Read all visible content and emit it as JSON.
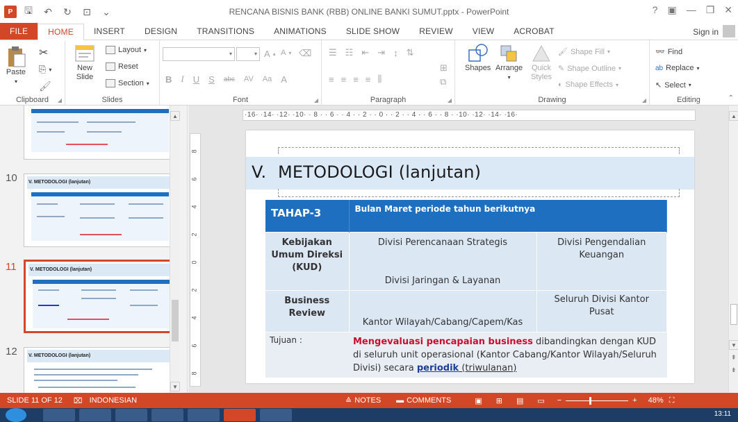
{
  "window": {
    "title": "RENCANA BISNIS BANK (RBB) ONLINE BANKI SUMUT.pptx - PowerPoint",
    "app_logo": "P",
    "controls": [
      "?",
      "▣",
      "—",
      "❐",
      "✕"
    ]
  },
  "tabs": [
    {
      "label": "FILE"
    },
    {
      "label": "HOME"
    },
    {
      "label": "INSERT"
    },
    {
      "label": "DESIGN"
    },
    {
      "label": "TRANSITIONS"
    },
    {
      "label": "ANIMATIONS"
    },
    {
      "label": "SLIDE SHOW"
    },
    {
      "label": "REVIEW"
    },
    {
      "label": "VIEW"
    },
    {
      "label": "ACROBAT"
    }
  ],
  "sign_in": "Sign in",
  "ribbon": {
    "clipboard": {
      "label": "Clipboard",
      "paste": "Paste"
    },
    "slides": {
      "label": "Slides",
      "new_slide": "New Slide",
      "layout": "Layout",
      "reset": "Reset",
      "section": "Section"
    },
    "font": {
      "label": "Font",
      "bold": "B",
      "italic": "I",
      "underline": "U",
      "strike": "S",
      "abc": "abc",
      "aa": "Aa",
      "grow": "A",
      "shrink": "A"
    },
    "paragraph": {
      "label": "Paragraph"
    },
    "drawing": {
      "label": "Drawing",
      "shapes": "Shapes",
      "arrange": "Arrange",
      "quick_styles": "Quick Styles",
      "shape_fill": "Shape Fill",
      "shape_outline": "Shape Outline",
      "shape_effects": "Shape Effects"
    },
    "editing": {
      "label": "Editing",
      "find": "Find",
      "replace": "Replace",
      "select": "Select"
    }
  },
  "ruler": {
    "horizontal": "·16·  ·14·  ·12·  ·10·  · 8 ·  · 6 ·  · 4 ·  · 2 ·  · 0 ·  · 2 ·  · 4 ·  · 6 ·  · 8 ·  ·10·  ·12·  ·14·  ·16·",
    "vertical": [
      "8",
      "6",
      "4",
      "2",
      "0",
      "2",
      "4",
      "6",
      "8"
    ]
  },
  "thumbnails": [
    {
      "num": "10",
      "title": "V.  METODOLOGI (lanjutan)"
    },
    {
      "num": "11",
      "title": "V.  METODOLOGI (lanjutan)",
      "selected": true
    },
    {
      "num": "12",
      "title": "V.  METODOLOGI (lanjutan)"
    }
  ],
  "slide": {
    "title_num": "V.",
    "title": "METODOLOGI (lanjutan)",
    "header": {
      "c1": "TAHAP-3",
      "c2": "Bulan Maret periode tahun berikutnya"
    },
    "row1": {
      "label": "Kebijakan Umum Direksi (KUD)",
      "col2_top": "Divisi Perencanaan Strategis",
      "col2_bottom": "Divisi Jaringan & Layanan",
      "col3": "Divisi Pengendalian Keuangan"
    },
    "row2": {
      "label": "Business Review",
      "col2": "Kantor Wilayah/Cabang/Capem/Kas",
      "col3": "Seluruh Divisi Kantor Pusat"
    },
    "row3": {
      "label": "Tujuan :",
      "red": "Mengevaluasi pencapaian business",
      "text1": " dibandingkan dengan KUD di seluruh unit operasional (Kantor Cabang/Kantor Wilayah/Seluruh Divisi) secara ",
      "periodik": "periodik",
      "text2": " (triwulanan)"
    }
  },
  "status": {
    "slide": "SLIDE 11 OF 12",
    "language": "INDONESIAN",
    "notes": "NOTES",
    "comments": "COMMENTS",
    "zoom": "48%"
  },
  "clock": "13:11"
}
